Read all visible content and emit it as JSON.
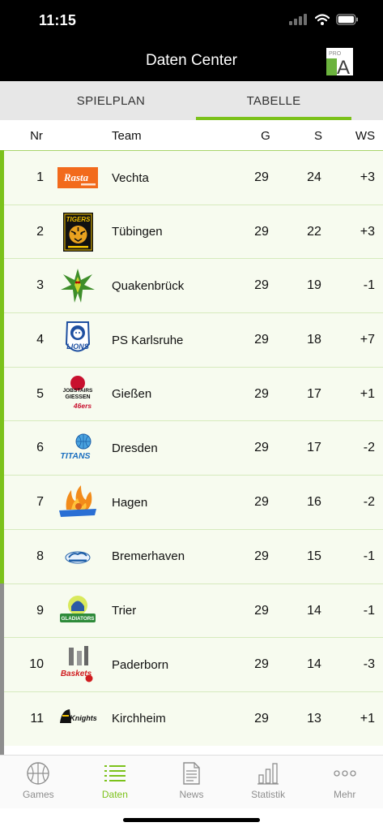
{
  "status_bar": {
    "time": "11:15",
    "icons": [
      "signal-icon",
      "wifi-icon",
      "battery-icon"
    ]
  },
  "header": {
    "title": "Daten Center",
    "logo": {
      "top": "PRO",
      "main": "A"
    }
  },
  "tabs": [
    {
      "label": "SPIELPLAN",
      "active": false
    },
    {
      "label": "TABELLE",
      "active": true
    }
  ],
  "table": {
    "columns": {
      "nr": "Nr",
      "team": "Team",
      "g": "G",
      "s": "S",
      "ws": "WS"
    },
    "rows": [
      {
        "nr": "1",
        "team": "Vechta",
        "g": "29",
        "s": "24",
        "ws": "+3",
        "bar_color": "#7cc21b",
        "logo_text": [
          "Rasta"
        ]
      },
      {
        "nr": "2",
        "team": "Tübingen",
        "g": "29",
        "s": "22",
        "ws": "+3",
        "bar_color": "#7cc21b",
        "logo_text": [
          "TIGERS"
        ]
      },
      {
        "nr": "3",
        "team": "Quakenbrück",
        "g": "29",
        "s": "19",
        "ws": "-1",
        "bar_color": "#7cc21b",
        "logo_text": []
      },
      {
        "nr": "4",
        "team": "PS Karlsruhe",
        "g": "29",
        "s": "18",
        "ws": "+7",
        "bar_color": "#7cc21b",
        "logo_text": [
          "LIONS"
        ]
      },
      {
        "nr": "5",
        "team": "Gießen",
        "g": "29",
        "s": "17",
        "ws": "+1",
        "bar_color": "#7cc21b",
        "logo_text": [
          "JOBSTAIRS",
          "GIESSEN",
          "46ers"
        ]
      },
      {
        "nr": "6",
        "team": "Dresden",
        "g": "29",
        "s": "17",
        "ws": "-2",
        "bar_color": "#7cc21b",
        "logo_text": [
          "TITANS"
        ]
      },
      {
        "nr": "7",
        "team": "Hagen",
        "g": "29",
        "s": "16",
        "ws": "-2",
        "bar_color": "#7cc21b",
        "logo_text": []
      },
      {
        "nr": "8",
        "team": "Bremerhaven",
        "g": "29",
        "s": "15",
        "ws": "-1",
        "bar_color": "#7cc21b",
        "logo_text": []
      },
      {
        "nr": "9",
        "team": "Trier",
        "g": "29",
        "s": "14",
        "ws": "-1",
        "bar_color": "#8e8e8e",
        "logo_text": [
          "GLADIATORS"
        ]
      },
      {
        "nr": "10",
        "team": "Paderborn",
        "g": "29",
        "s": "14",
        "ws": "-3",
        "bar_color": "#8e8e8e",
        "logo_text": [
          "Baskets"
        ]
      },
      {
        "nr": "11",
        "team": "Kirchheim",
        "g": "29",
        "s": "13",
        "ws": "+1",
        "bar_color": "#8e8e8e",
        "logo_text": [
          "Knights"
        ]
      }
    ]
  },
  "bottom_nav": [
    {
      "label": "Games",
      "icon": "basketball-icon",
      "active": false
    },
    {
      "label": "Daten",
      "icon": "list-icon",
      "active": true
    },
    {
      "label": "News",
      "icon": "document-icon",
      "active": false
    },
    {
      "label": "Statistik",
      "icon": "bar-chart-icon",
      "active": false
    },
    {
      "label": "Mehr",
      "icon": "more-dots-icon",
      "active": false
    }
  ],
  "colors": {
    "accent": "#7cc21b",
    "playoff_bar": "#7cc21b",
    "other_bar": "#8e8e8e",
    "header_bg": "#000000",
    "tab_bg": "#e7e7e7",
    "row_bg": "#f7fbef",
    "nav_inactive": "#8e8e8e"
  }
}
